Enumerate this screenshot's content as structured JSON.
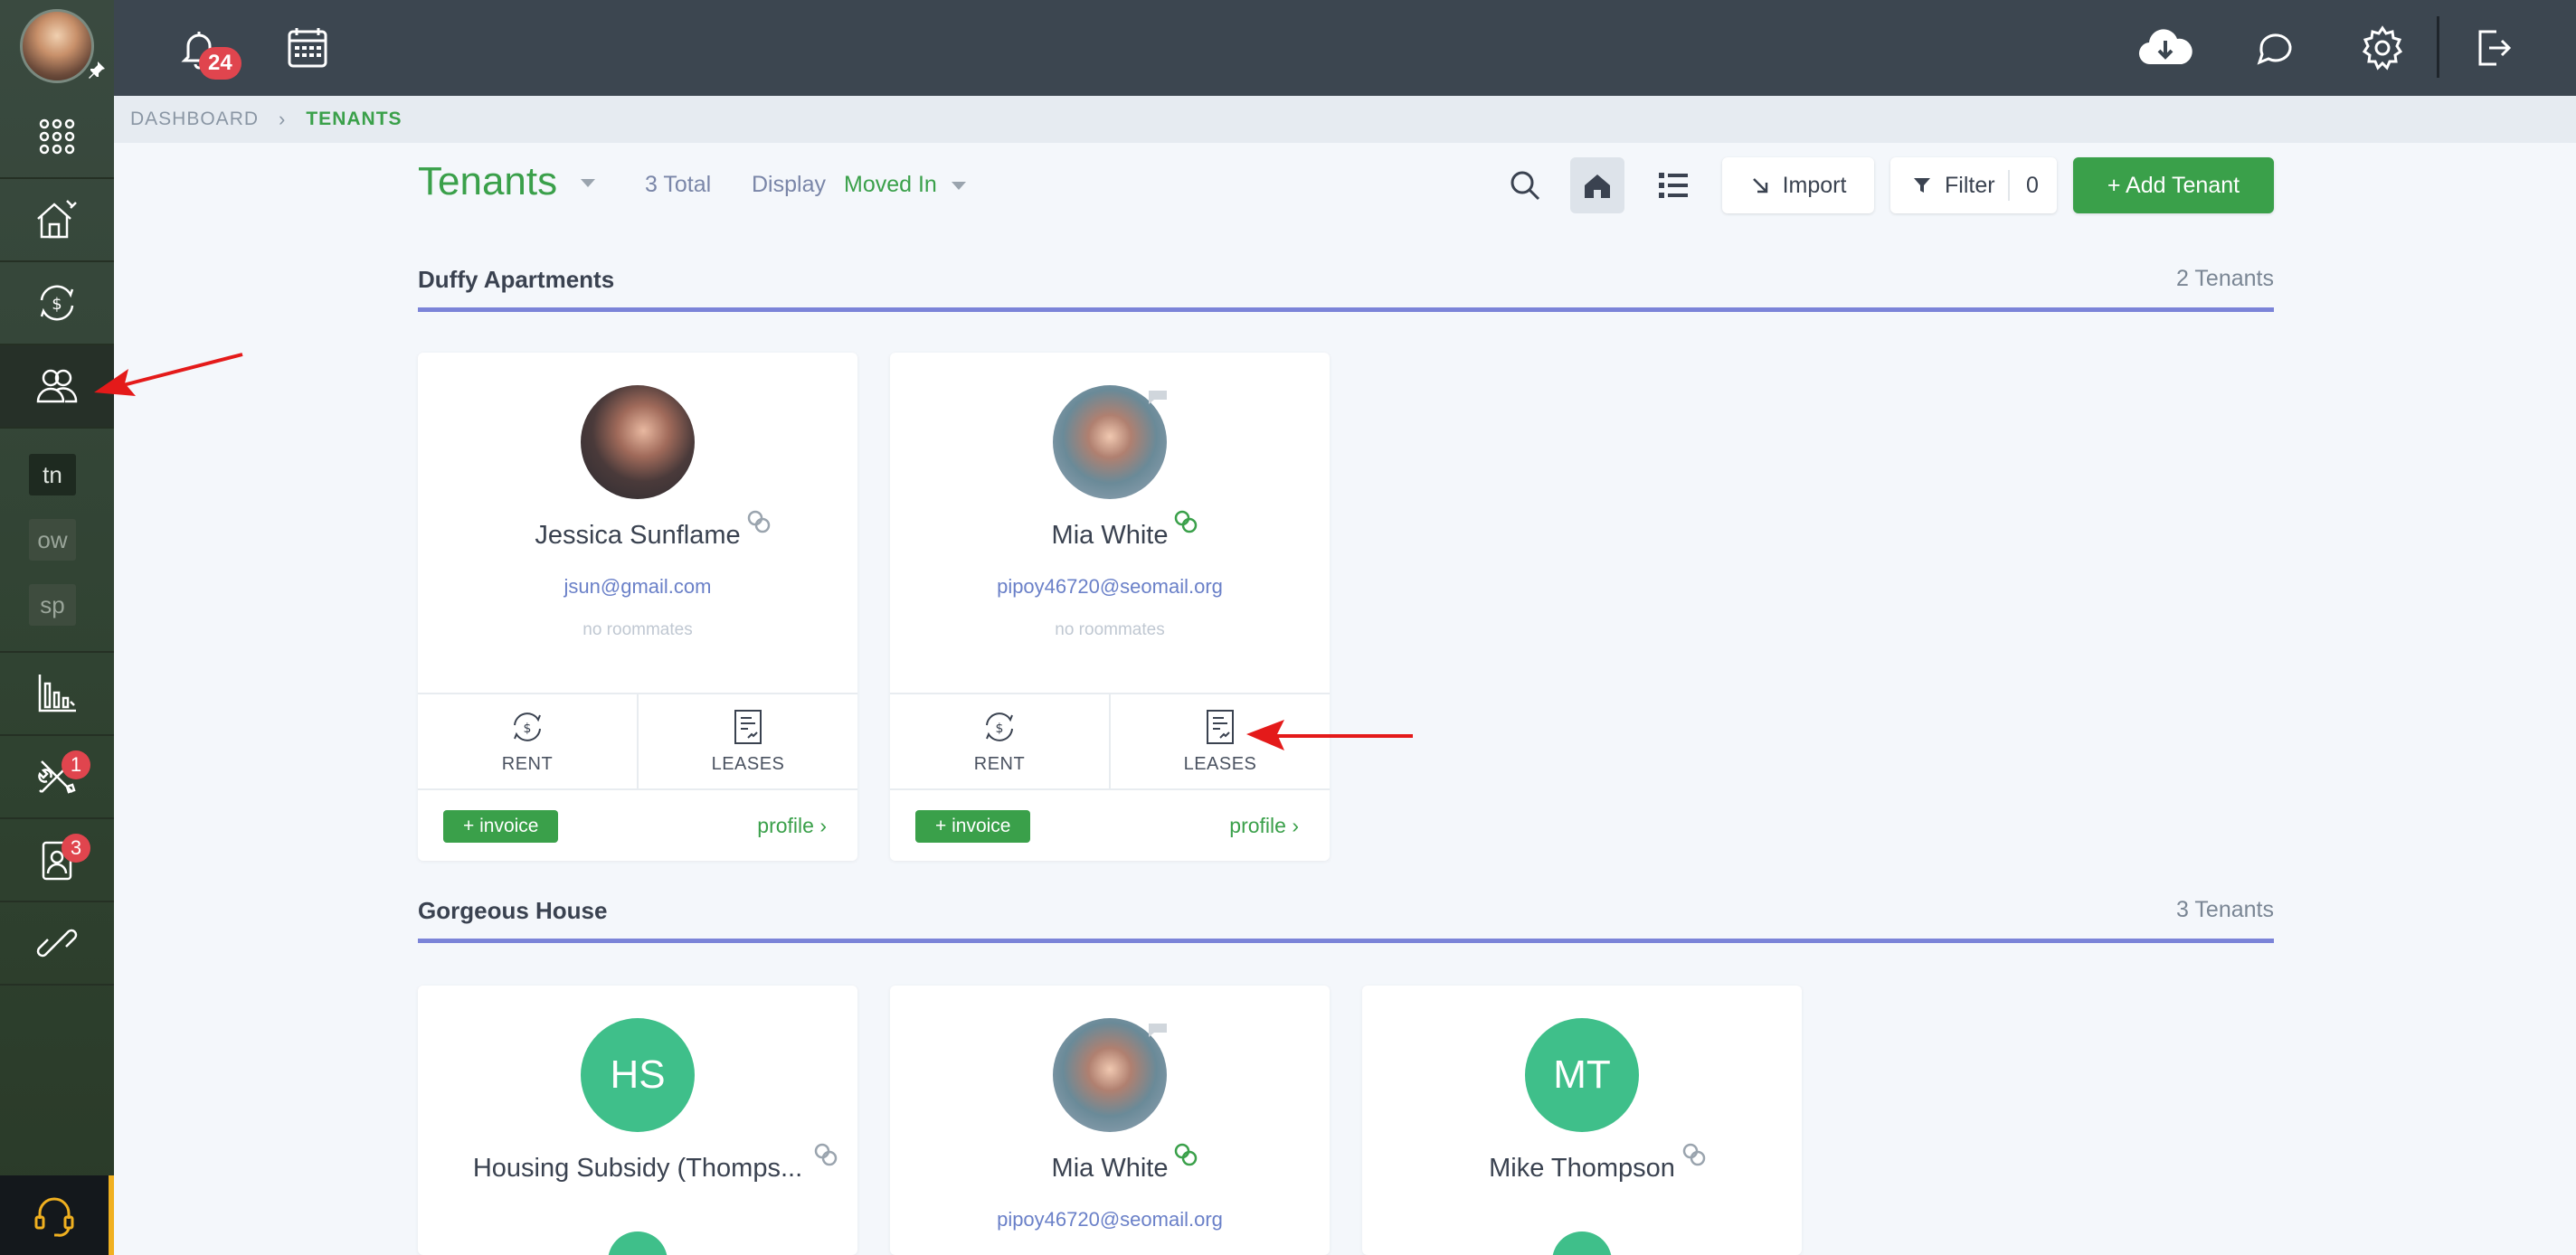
{
  "topbar": {
    "notification_count": "24",
    "icons": [
      "bell-icon",
      "calendar-icon",
      "cloud-download-icon",
      "chat-icon",
      "gear-icon",
      "logout-icon"
    ]
  },
  "sidebar": {
    "tags": [
      "tn",
      "ow",
      "sp"
    ],
    "maintenance_badge": "1",
    "applicants_badge": "3"
  },
  "breadcrumb": {
    "parent": "DASHBOARD",
    "current": "TENANTS"
  },
  "header": {
    "title": "Tenants",
    "total": "3 Total",
    "display_label": "Display",
    "display_value": "Moved In",
    "import_label": "Import",
    "filter_label": "Filter",
    "filter_count": "0",
    "add_label": "+ Add Tenant"
  },
  "sections": [
    {
      "title": "Duffy Apartments",
      "count": "2 Tenants",
      "cards": [
        {
          "name": "Jessica Sunflame",
          "email": "jsun@gmail.com",
          "note": "no roommates",
          "rent": "RENT",
          "leases": "LEASES",
          "invoice": "+ invoice",
          "profile": "profile ›"
        },
        {
          "name": "Mia White",
          "email": "pipoy46720@seomail.org",
          "note": "no roommates",
          "rent": "RENT",
          "leases": "LEASES",
          "invoice": "+ invoice",
          "profile": "profile ›"
        }
      ]
    },
    {
      "title": "Gorgeous House",
      "count": "3 Tenants",
      "cards": [
        {
          "initials": "HS",
          "name": "Housing Subsidy (Thomps..."
        },
        {
          "name": "Mia White",
          "email": "pipoy46720@seomail.org"
        },
        {
          "initials": "MT",
          "name": "Mike Thompson"
        }
      ]
    }
  ],
  "colors": {
    "accent_green": "#3aa04a",
    "section_line": "#7b84d8",
    "topbar": "#3c4650",
    "badge_red": "#e0454e",
    "avatar_initials": "#3fbf8a"
  }
}
